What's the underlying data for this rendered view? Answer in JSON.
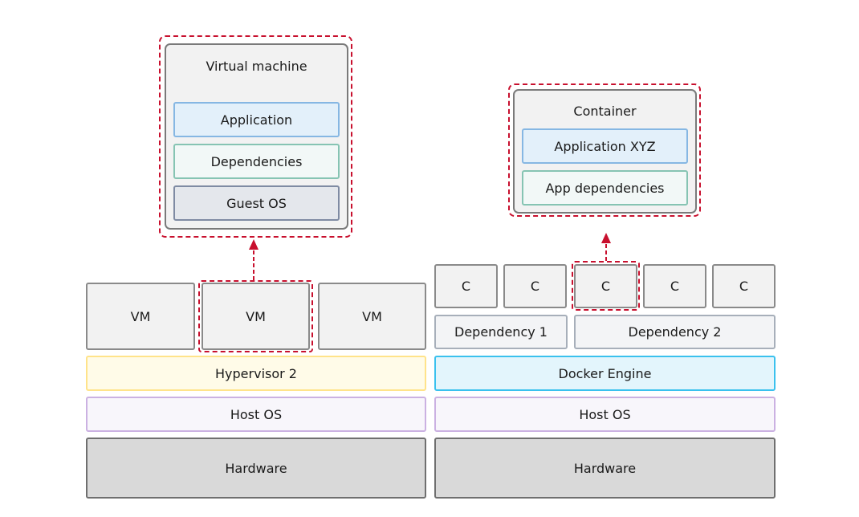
{
  "vm_side": {
    "detail_title": "Virtual machine",
    "detail_layers": [
      "Application",
      "Dependencies",
      "Guest OS"
    ],
    "vms": [
      "VM",
      "VM",
      "VM"
    ],
    "hypervisor": "Hypervisor 2",
    "host_os": "Host OS",
    "hardware": "Hardware"
  },
  "container_side": {
    "detail_title": "Container",
    "detail_layers": [
      "Application XYZ",
      "App dependencies"
    ],
    "containers": [
      "C",
      "C",
      "C",
      "C",
      "C"
    ],
    "dependencies": [
      "Dependency 1",
      "Dependency 2"
    ],
    "engine": "Docker Engine",
    "host_os": "Host OS",
    "hardware": "Hardware"
  },
  "colors": {
    "highlight": "#c8102e",
    "docker": "#3ac1ee",
    "hypervisor": "#ffe38a",
    "host_os": "#cbb1e2"
  }
}
